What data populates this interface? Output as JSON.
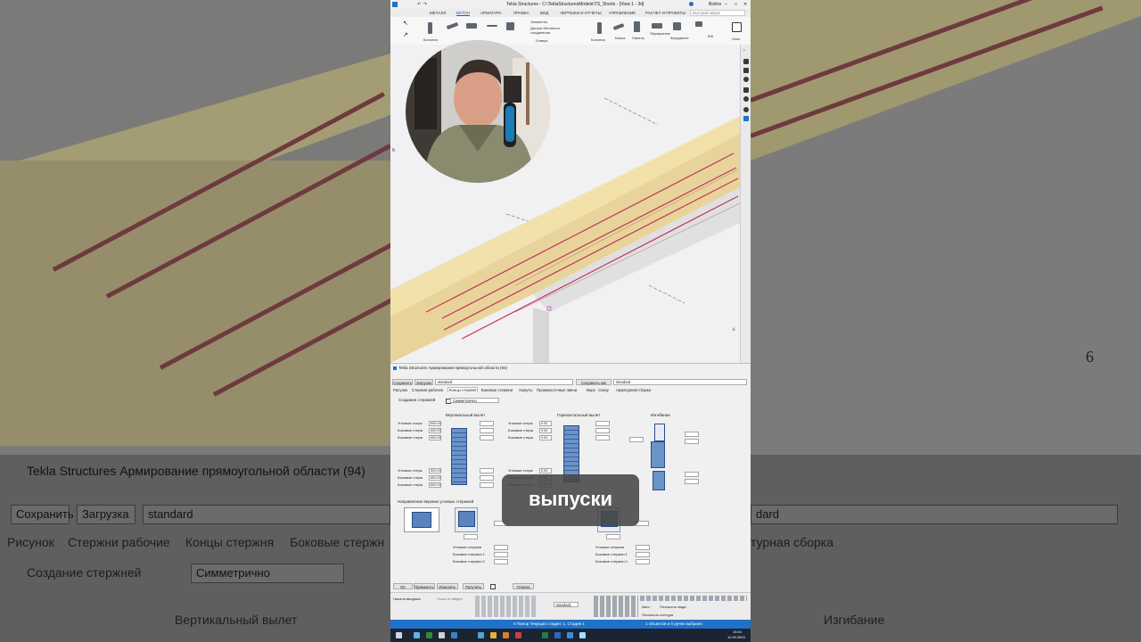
{
  "background": {
    "dialog_title": "Tekla Structures  Армирование прямоугольной области (94)",
    "save_button": "Сохранить",
    "load_button": "Загрузка",
    "preset_value": "standard",
    "right_preset_value": "dard",
    "tabs": [
      "Рисунок",
      "Стержни рабочие",
      "Концы стержня",
      "Боковые стержн"
    ],
    "right_tab": "турная сборка",
    "creation_label": "Создание стержней",
    "creation_value": "Симметрично",
    "vertical_label": "Вертикальный вылет",
    "bending_label": "Изгибание",
    "grid_label": "6"
  },
  "app": {
    "title": "Tekla Structures - C:\\TeklaStructuresModels\\TS_Shorts - [View 1 - 3d]",
    "user": "Войти",
    "menu": [
      "МЕТАЛЛ",
      "БЕТОН",
      "АРМАТУРА",
      "ПРАВКА",
      "ВИД",
      "ЧЕРТЕЖИ И ОТЧЕТЫ",
      "УПРАВЛЕНИЕ",
      "РАСЧЕТ И ПРОЕКТЫ"
    ],
    "active_menu": "БЕТОН",
    "search_placeholder": "Быстрый запуск",
    "ribbon": {
      "column": "Колонна",
      "elements": "Элементы",
      "embed_details": "Детали бетонного соединения",
      "rebar_set": "Отверк",
      "col2": "Колонна",
      "beam": "Балка",
      "panel": "Панель",
      "slab": "Перекрытие",
      "foundation": "Фундамент",
      "window": "Окно",
      "jb": "ЖБ"
    },
    "viewport_grid_left": "6",
    "viewport_grid_right": "6"
  },
  "dialog": {
    "title": "Tekla Structures  Армирование прямоугольной области (94)",
    "save": "Сохранить",
    "load": "Загрузка",
    "preset": "standard",
    "save_as": "Сохранить как",
    "save_as_value": "standard",
    "tabs": [
      "Рисунок",
      "Стержни рабочие",
      "Концы стержня",
      "Боковые стержни",
      "Хомуты",
      "Промежуточные звена",
      "Верх",
      "Снизу",
      "Арматурная сборка"
    ],
    "active_tab": "Концы стержня",
    "creation_label": "Создание стержней",
    "creation_value": "Симметрично",
    "vertical_title": "Вертикальный вылет",
    "horizontal_title": "Горизонтальный вылет",
    "bending_title": "Изгибание",
    "corner_label": "Угловые стерж",
    "side_label": "Боковые стерж",
    "vert_values_top": [
      "600.00",
      "600.00",
      "600.00"
    ],
    "vert_values_bottom": [
      "600.00",
      "600.00",
      "600.00"
    ],
    "horiz_values": [
      "0.00",
      "0.00",
      "0.00"
    ],
    "horiz_values_bottom": [
      "0.00",
      "0.00",
      "0.00"
    ],
    "direction_label": "Направление верхних угловых стержней",
    "bottom_labels": [
      "Угловые стержни",
      "Боковые стержни 1",
      "Боковые стержни 2"
    ],
    "buttons": [
      "OK",
      "Применить",
      "Изменить",
      "Получить",
      "Отмена"
    ]
  },
  "bottom": {
    "start_label": "Начало вводных",
    "search_label": "Поиск в найден",
    "standard": "standard",
    "auto": "Авто",
    "plane_view": "Плоскость вида",
    "plane_contour": "Плоскость контура"
  },
  "status": {
    "text": "0  Панор Текущая стадия: 1, Стадия 1",
    "selection": "1 объектов и 0 ручек выбрано"
  },
  "taskbar": {
    "time": "15:04",
    "date": "11.09.2023"
  },
  "caption": "выпуски",
  "colors": {
    "accent": "#1f72c8",
    "slab": "#eed9a1",
    "rebar_red": "#c0335b"
  }
}
